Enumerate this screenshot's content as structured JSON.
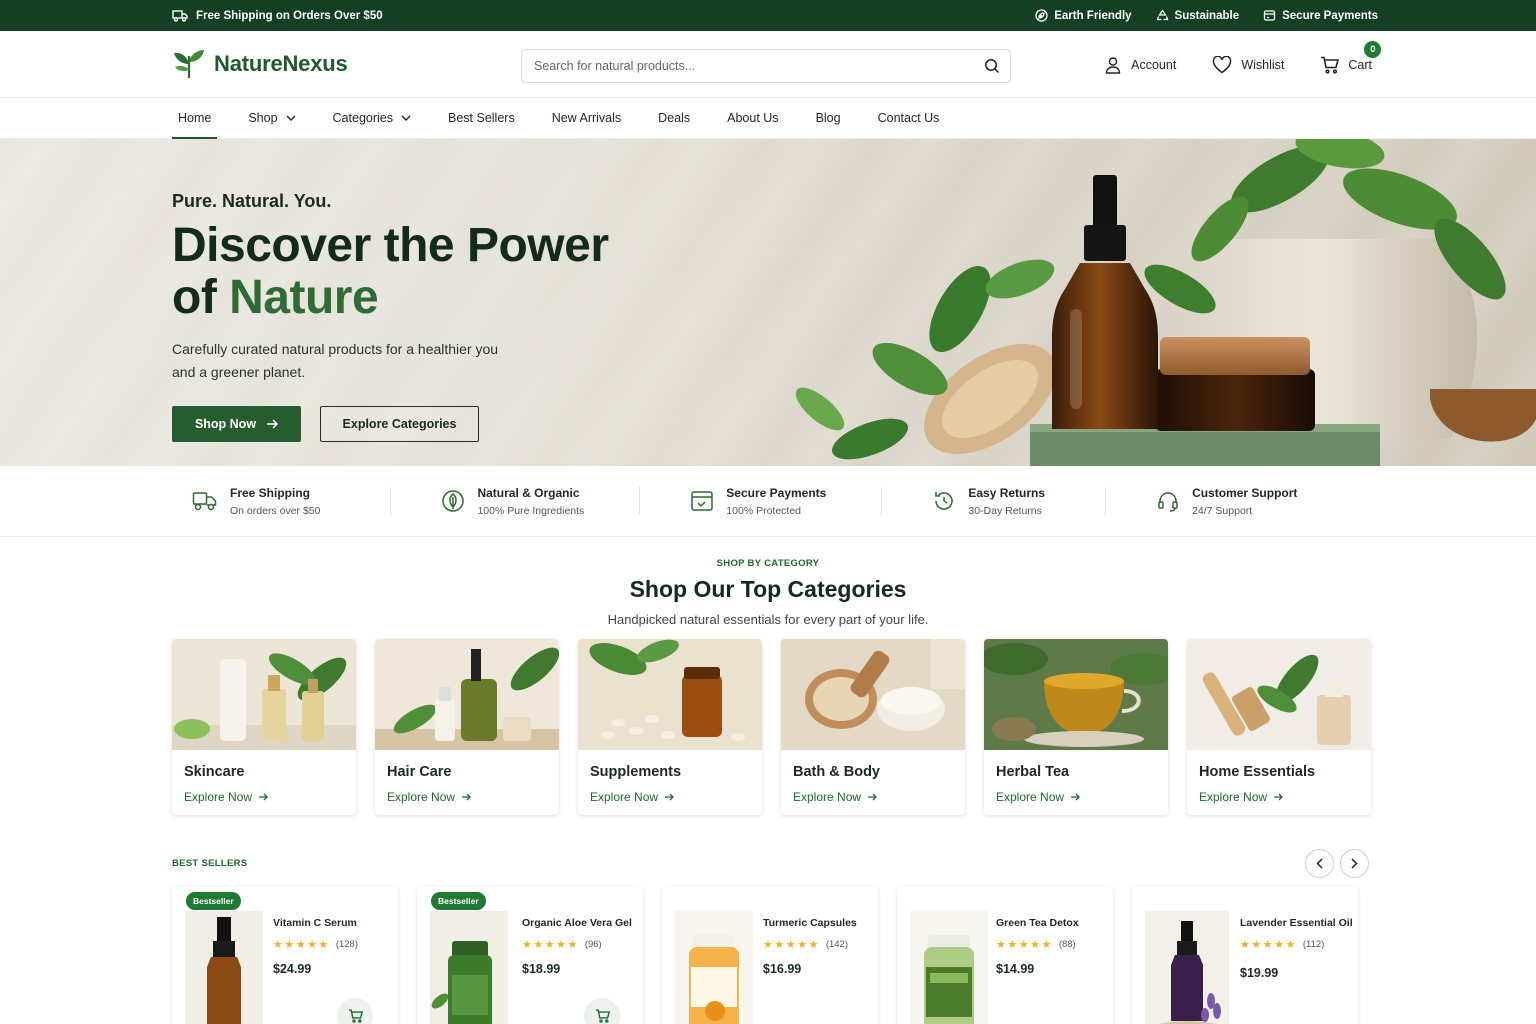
{
  "topbar": {
    "shipping": "Free Shipping on Orders Over $50",
    "perks": [
      "Earth Friendly",
      "Sustainable",
      "Secure Payments"
    ]
  },
  "header": {
    "brand": "NatureNexus",
    "search_placeholder": "Search for natural products...",
    "account": "Account",
    "wishlist": "Wishlist",
    "cart": "Cart",
    "cart_count": "0"
  },
  "nav": {
    "items": [
      "Home",
      "Shop",
      "Categories",
      "Best Sellers",
      "New Arrivals",
      "Deals",
      "About Us",
      "Blog",
      "Contact Us"
    ]
  },
  "hero": {
    "kicker": "Pure. Natural. You.",
    "title_line1": "Discover the Power",
    "title_of": "of ",
    "title_accent": "Nature",
    "subtitle": "Carefully curated natural products for a healthier you and a greener planet.",
    "primary_cta": "Shop Now",
    "secondary_cta": "Explore Categories"
  },
  "features": [
    {
      "title": "Free Shipping",
      "sub": "On orders over $50"
    },
    {
      "title": "Natural & Organic",
      "sub": "100% Pure Ingredients"
    },
    {
      "title": "Secure Payments",
      "sub": "100% Protected"
    },
    {
      "title": "Easy Returns",
      "sub": "30-Day Returns"
    },
    {
      "title": "Customer Support",
      "sub": "24/7 Support"
    }
  ],
  "categories": {
    "kicker": "SHOP BY CATEGORY",
    "title": "Shop Our Top Categories",
    "subtitle": "Handpicked natural essentials for every part of your life.",
    "link_label": "Explore Now",
    "items": [
      "Skincare",
      "Hair Care",
      "Supplements",
      "Bath & Body",
      "Herbal Tea",
      "Home Essentials"
    ]
  },
  "bestsellers": {
    "label": "BEST SELLERS",
    "badge": "Bestseller",
    "products": [
      {
        "name": "Vitamin C Serum",
        "stars": "★★★★★",
        "reviews": "(128)",
        "price": "$24.99"
      },
      {
        "name": "Organic Aloe Vera Gel",
        "stars": "★★★★★",
        "reviews": "(96)",
        "price": "$18.99"
      },
      {
        "name": "Turmeric Capsules",
        "stars": "★★★★★",
        "reviews": "(142)",
        "price": "$16.99"
      },
      {
        "name": "Green Tea Detox",
        "stars": "★★★★★",
        "reviews": "(88)",
        "price": "$14.99"
      },
      {
        "name": "Lavender Essential Oil",
        "stars": "★★★★★",
        "reviews": "(112)",
        "price": "$19.99"
      }
    ]
  },
  "colors": {
    "brand_dark": "#153f22",
    "brand": "#255d2f",
    "accent": "#1f7a32",
    "star": "#f2b01e"
  }
}
